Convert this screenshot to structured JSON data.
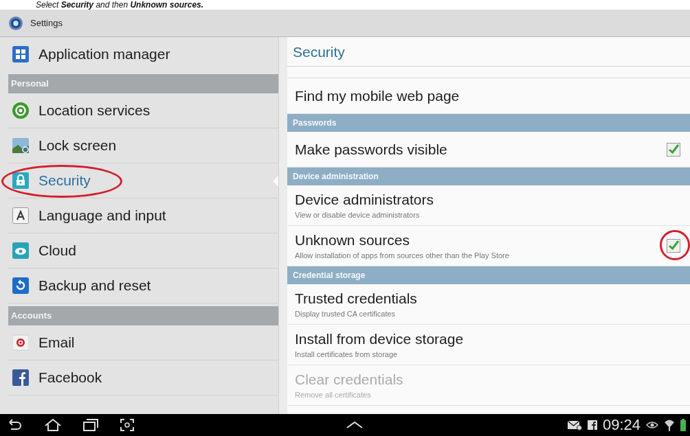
{
  "caption": "Select **Security** and then **Unknown sources.**",
  "title_bar": {
    "title": "Settings"
  },
  "sidebar": {
    "items": [
      {
        "kind": "item",
        "label": "Application manager",
        "selected": false,
        "circled": false
      },
      {
        "kind": "header",
        "label": "Personal"
      },
      {
        "kind": "item",
        "label": "Location services",
        "selected": false,
        "circled": false
      },
      {
        "kind": "item",
        "label": "Lock screen",
        "selected": false,
        "circled": false
      },
      {
        "kind": "item",
        "label": "Security",
        "selected": true,
        "circled": true
      },
      {
        "kind": "item",
        "label": "Language and input",
        "selected": false,
        "circled": false
      },
      {
        "kind": "item",
        "label": "Cloud",
        "selected": false,
        "circled": false
      },
      {
        "kind": "item",
        "label": "Backup and reset",
        "selected": false,
        "circled": false
      },
      {
        "kind": "header",
        "label": "Accounts"
      },
      {
        "kind": "item",
        "label": "Email",
        "selected": false,
        "circled": false
      },
      {
        "kind": "item",
        "label": "Facebook",
        "selected": false,
        "circled": false
      }
    ]
  },
  "detail": {
    "title": "Security",
    "rows": [
      {
        "kind": "item",
        "title": "Find my mobile web page",
        "disabled": false
      },
      {
        "kind": "header",
        "title": "Passwords"
      },
      {
        "kind": "checkbox",
        "title": "Make passwords visible",
        "checked": true,
        "circled": false,
        "disabled": false
      },
      {
        "kind": "header",
        "title": "Device administration"
      },
      {
        "kind": "item",
        "title": "Device administrators",
        "subtitle": "View or disable device administrators",
        "disabled": false
      },
      {
        "kind": "checkbox",
        "title": "Unknown sources",
        "subtitle": "Allow installation of apps from sources other than the Play Store",
        "checked": true,
        "circled": true,
        "disabled": false
      },
      {
        "kind": "header",
        "title": "Credential storage"
      },
      {
        "kind": "item",
        "title": "Trusted credentials",
        "subtitle": "Display trusted CA certificates",
        "disabled": false
      },
      {
        "kind": "item",
        "title": "Install from device storage",
        "subtitle": "Install certificates from storage",
        "disabled": false
      },
      {
        "kind": "item",
        "title": "Clear credentials",
        "subtitle": "Remove all certificates",
        "disabled": true
      }
    ]
  },
  "nav_bar": {
    "time": "09:24"
  }
}
